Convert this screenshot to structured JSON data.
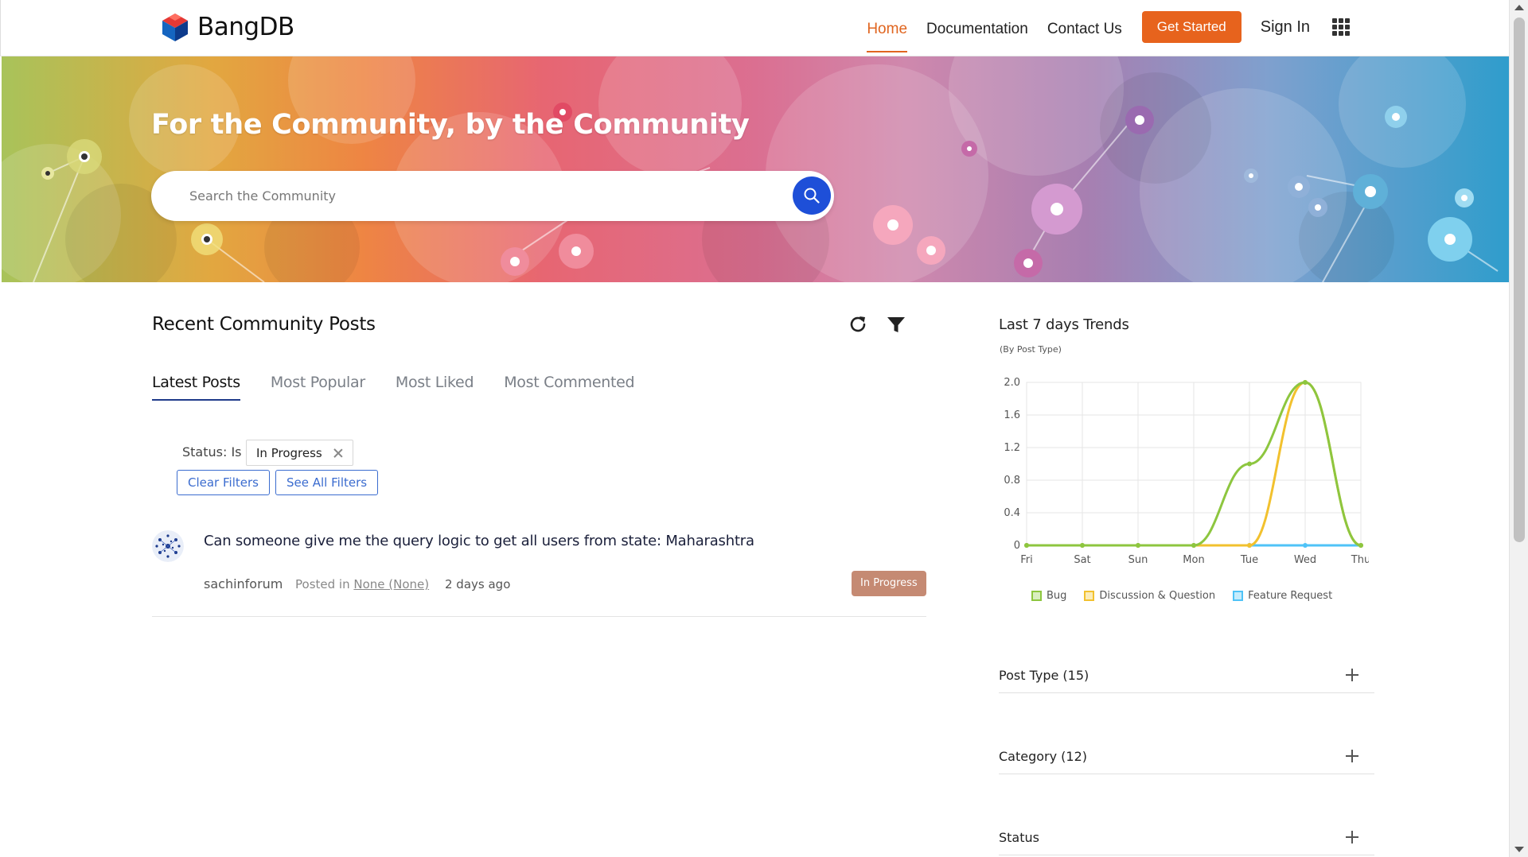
{
  "header": {
    "logo_text": "BangDB",
    "nav": [
      "Home",
      "Documentation",
      "Contact Us"
    ],
    "get_started": "Get Started",
    "sign_in": "Sign In"
  },
  "hero": {
    "title": "For the Community, by the Community",
    "search_placeholder": "Search the Community"
  },
  "posts": {
    "title": "Recent Community Posts",
    "tabs": [
      "Latest Posts",
      "Most Popular",
      "Most Liked",
      "Most Commented"
    ],
    "filter": {
      "label": "Status: Is",
      "value": "In Progress",
      "clear": "Clear Filters",
      "see_all": "See All Filters"
    },
    "items": [
      {
        "title": "Can someone give me the query logic to get all users from state: Maharashtra",
        "author": "sachinforum",
        "posted_in_label": "Posted in",
        "posted_in_link": "None (None)",
        "time": "2 days ago",
        "status": "In Progress"
      }
    ]
  },
  "sidebar": {
    "trends_title": "Last 7 days Trends",
    "trends_subtitle": "(By Post Type)",
    "accordions": [
      "Post Type (15)",
      "Category (12)",
      "Status"
    ]
  },
  "colors": {
    "accent": "#e7631d",
    "search_button": "#1e4fd8",
    "badge": "#c58a73",
    "bug": "#8dc63f",
    "discussion": "#f2c12e",
    "feature": "#4fc3f7"
  },
  "chart_data": {
    "type": "line",
    "categories": [
      "Fri",
      "Sat",
      "Sun",
      "Mon",
      "Tue",
      "Wed",
      "Thu"
    ],
    "ylim": [
      0,
      2.0
    ],
    "yticks": [
      "0",
      "0.4",
      "0.8",
      "1.2",
      "1.6",
      "2.0"
    ],
    "grid": true,
    "legend_position": "bottom",
    "series": [
      {
        "name": "Bug",
        "color": "#8dc63f",
        "values": [
          0,
          0,
          0,
          0,
          1,
          2,
          0
        ]
      },
      {
        "name": "Discussion & Question",
        "color": "#f2c12e",
        "values": [
          0,
          0,
          0,
          0,
          0,
          2,
          0
        ]
      },
      {
        "name": "Feature Request",
        "color": "#4fc3f7",
        "values": [
          0,
          0,
          0,
          0,
          0,
          0,
          0
        ]
      }
    ]
  }
}
